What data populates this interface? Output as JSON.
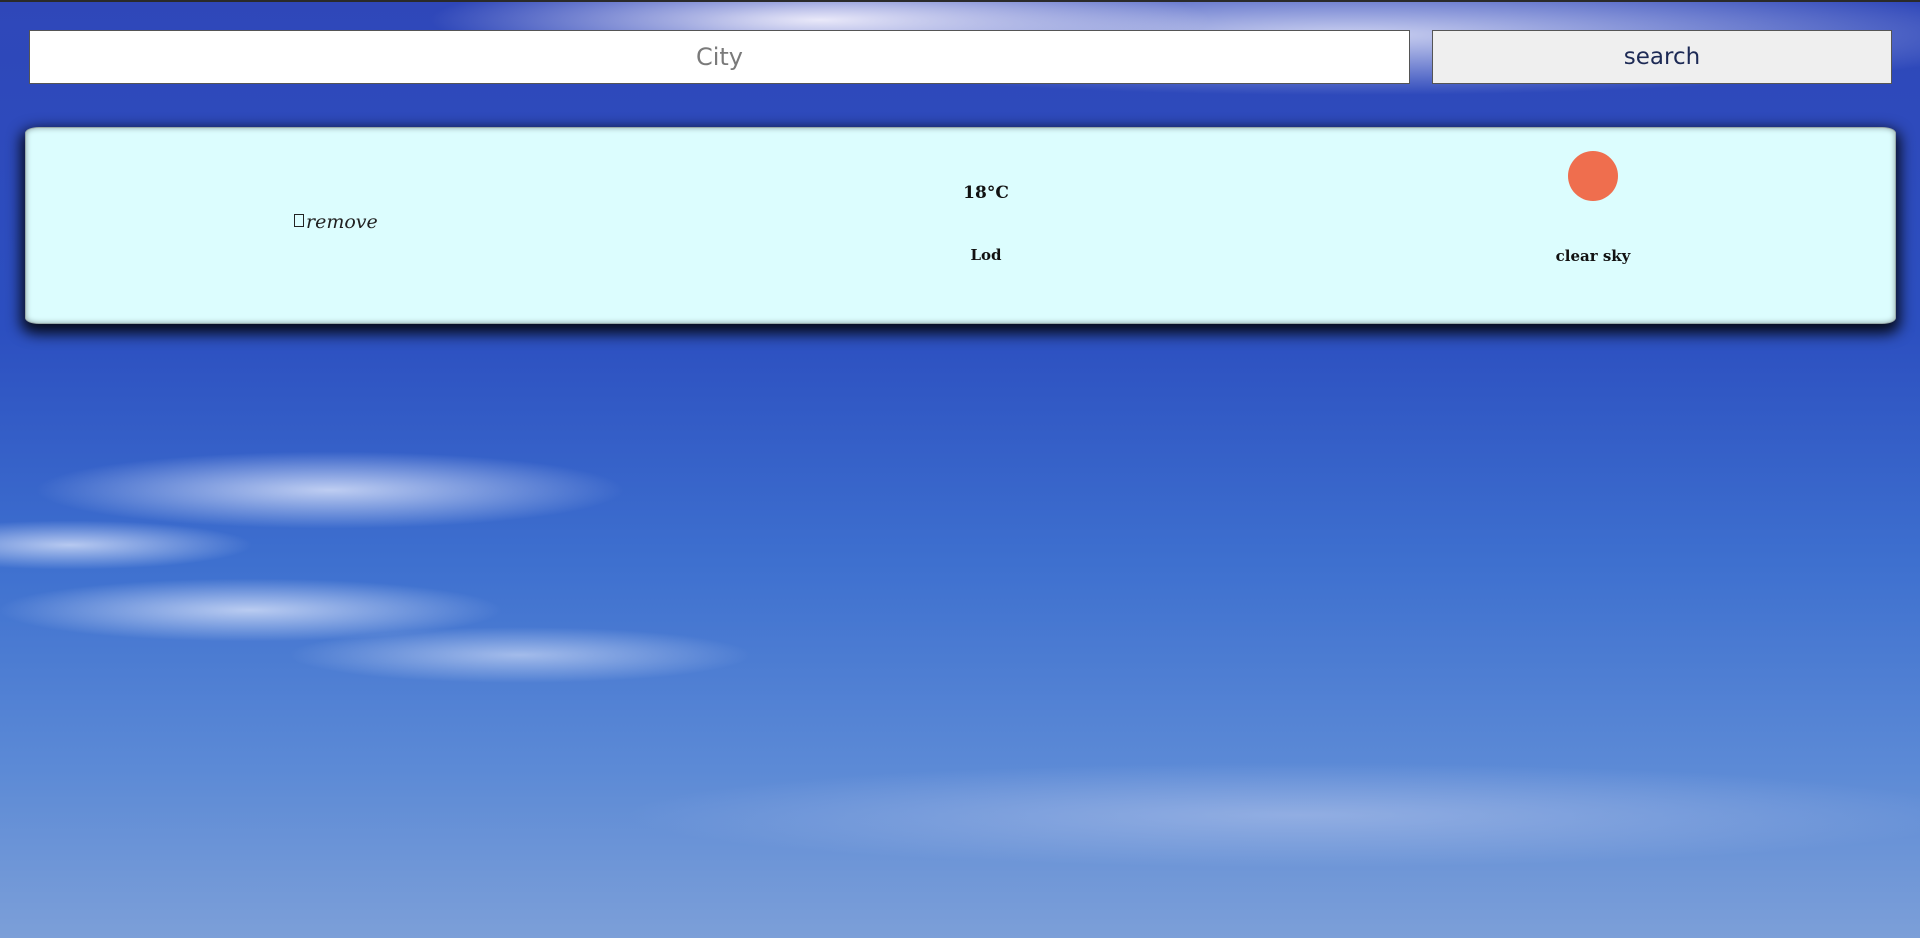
{
  "search": {
    "placeholder": "City",
    "value": "",
    "button_label": "search"
  },
  "card": {
    "remove_label": "remove",
    "temperature": "18°C",
    "city": "Lod",
    "description": "clear sky",
    "icon": "sun-icon",
    "icon_color": "#ef6e4e",
    "background_color": "#dcfdfe"
  },
  "colors": {
    "sky_top": "#2f47b9",
    "sky_bottom": "#7c9fd8"
  }
}
